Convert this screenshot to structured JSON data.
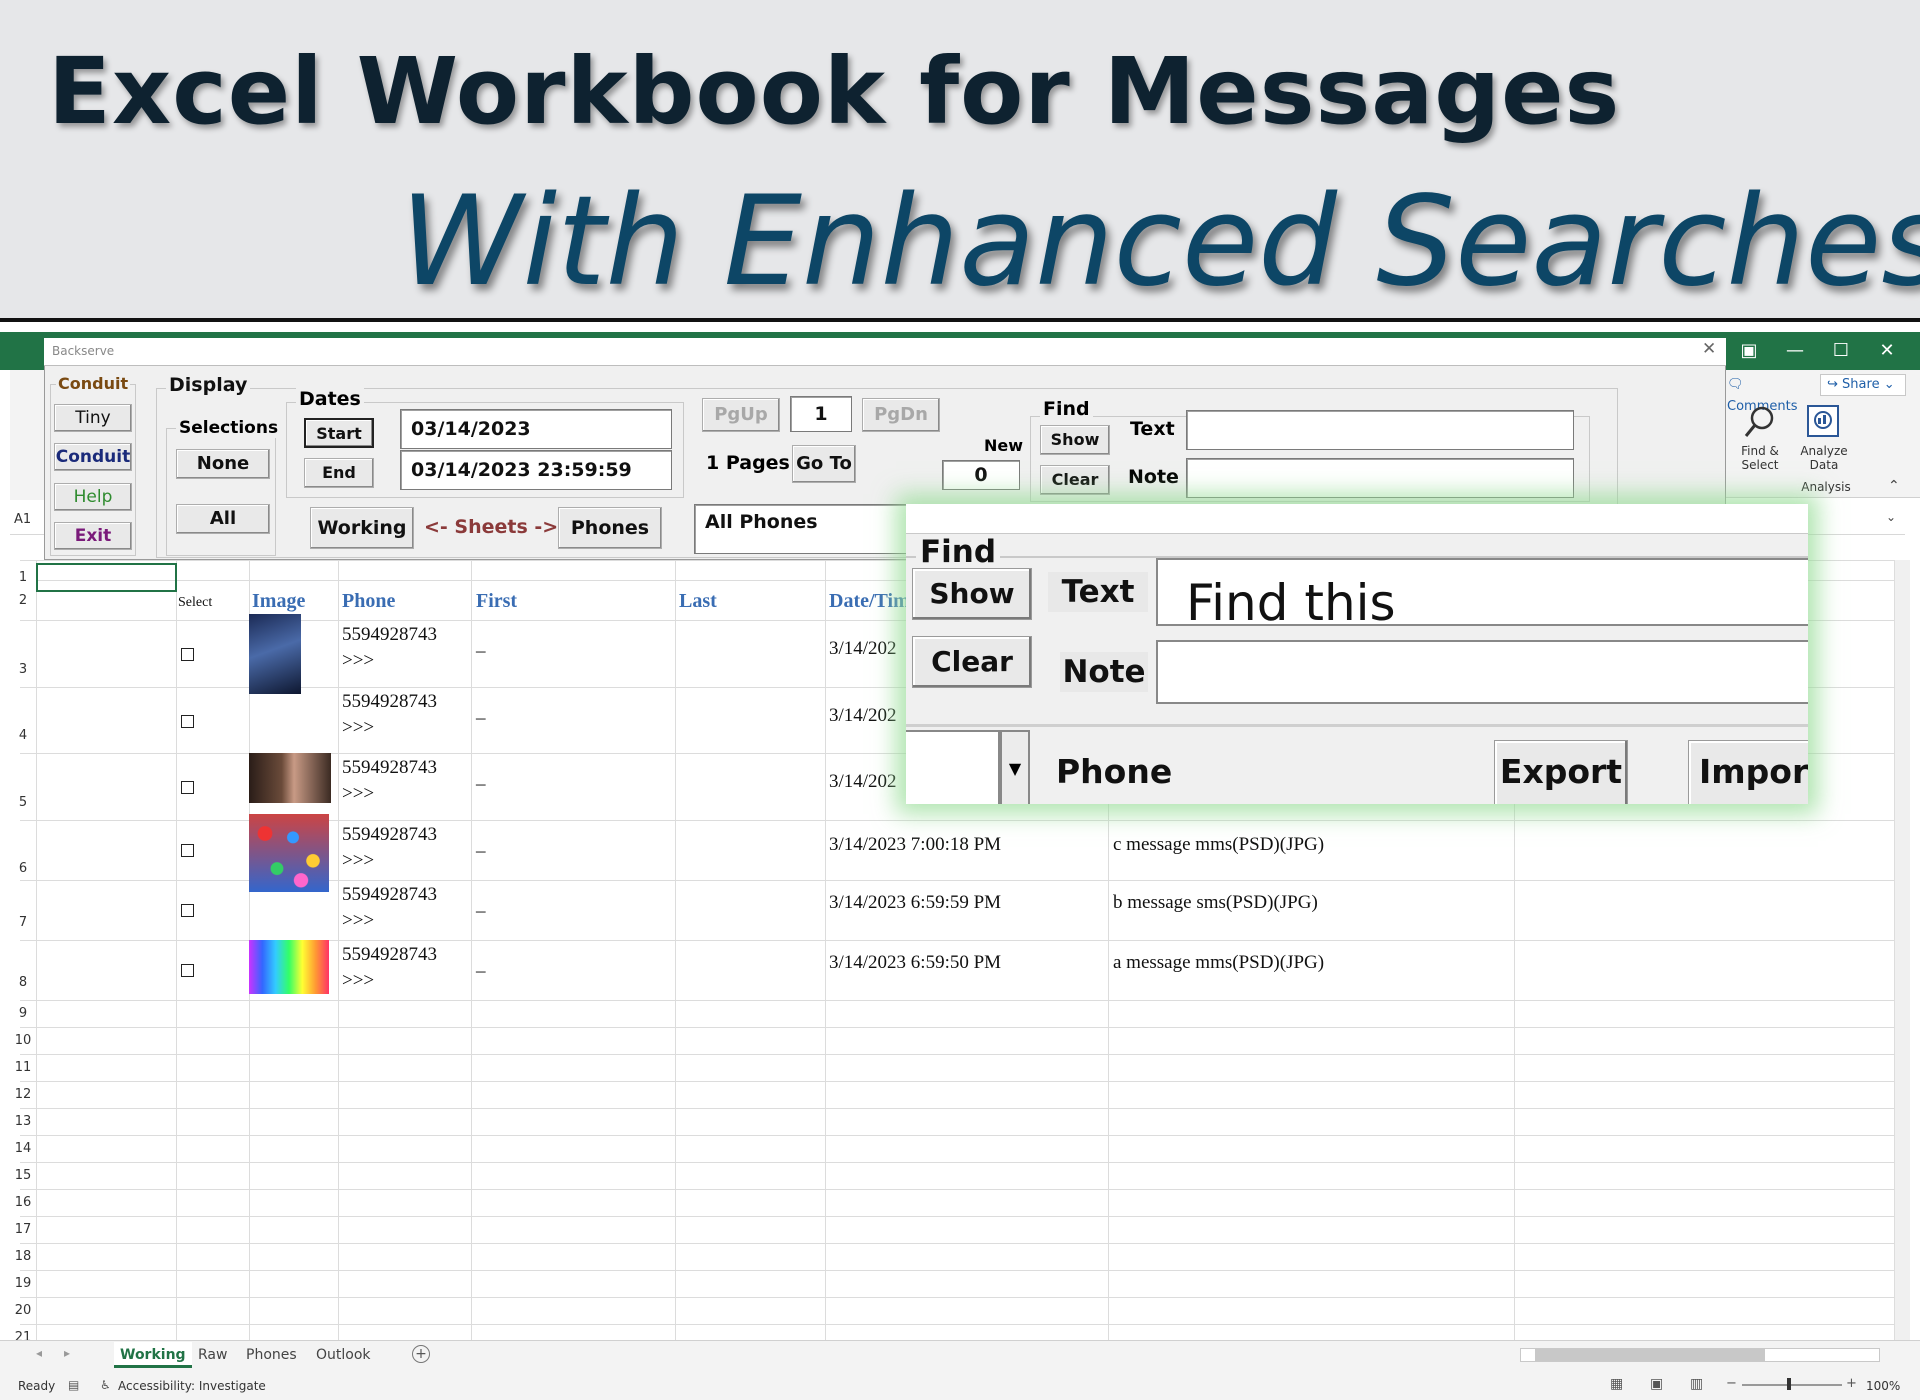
{
  "banner": {
    "title": "Excel Workbook for Messages",
    "subtitle": "With Enhanced Searches"
  },
  "excel": {
    "ribbon": {
      "comments": "Comments",
      "share": "Share",
      "find_select": "Find & Select",
      "analyze_data": "Analyze Data",
      "analysis_group": "Analysis"
    },
    "name_box": "A1",
    "columns": [
      "Select",
      "Image",
      "Phone",
      "First",
      "Last",
      "Date/Time"
    ],
    "row_numbers": [
      "1",
      "2",
      "3",
      "4",
      "5",
      "6",
      "7",
      "8",
      "9",
      "10",
      "11",
      "12",
      "13",
      "14",
      "15",
      "16",
      "17",
      "18",
      "19",
      "20",
      "21"
    ],
    "rows": [
      {
        "phone": "5594928743",
        "phone2": ">>>",
        "first": "_",
        "datetime": "3/14/202",
        "message": ""
      },
      {
        "phone": "5594928743",
        "phone2": ">>>",
        "first": "_",
        "datetime": "3/14/202",
        "message": ""
      },
      {
        "phone": "5594928743",
        "phone2": ">>>",
        "first": "_",
        "datetime": "3/14/202",
        "message": ""
      },
      {
        "phone": "5594928743",
        "phone2": ">>>",
        "first": "_",
        "datetime": "3/14/2023 7:00:18 PM",
        "message": "c message mms(PSD)(JPG)"
      },
      {
        "phone": "5594928743",
        "phone2": ">>>",
        "first": "_",
        "datetime": "3/14/2023 6:59:59 PM",
        "message": "b message sms(PSD)(JPG)"
      },
      {
        "phone": "5594928743",
        "phone2": ">>>",
        "first": "_",
        "datetime": "3/14/2023 6:59:50 PM",
        "message": "a message mms(PSD)(JPG)"
      }
    ],
    "sheet_tabs": [
      "Working",
      "Raw",
      "Phones",
      "Outlook"
    ],
    "active_tab": "Working",
    "status": {
      "ready": "Ready",
      "accessibility": "Accessibility: Investigate",
      "zoom": "100%"
    }
  },
  "form": {
    "window_title": "Backserve",
    "conduit_group": {
      "label": "Conduit",
      "tiny": "Tiny",
      "conduit": "Conduit",
      "help": "Help",
      "exit": "Exit"
    },
    "display_label": "Display",
    "selections": {
      "label": "Selections",
      "none": "None",
      "all": "All"
    },
    "dates": {
      "label": "Dates",
      "start": "Start",
      "end": "End",
      "start_value": "03/14/2023",
      "end_value": "03/14/2023 23:59:59"
    },
    "paging": {
      "pgup": "PgUp",
      "page": "1",
      "pgdn": "PgDn",
      "pages": "1 Pages",
      "goto": "Go To",
      "new_label": "New",
      "new_value": "0"
    },
    "sheets": {
      "working": "Working",
      "label": "<- Sheets ->",
      "phones": "Phones"
    },
    "phones_dropdown": "All Phones",
    "find": {
      "label": "Find",
      "show": "Show",
      "clear": "Clear",
      "text_label": "Text",
      "note_label": "Note",
      "text_value": "",
      "note_value": ""
    }
  },
  "zoom": {
    "find_label": "Find",
    "show": "Show",
    "clear": "Clear",
    "text_label": "Text",
    "text_value": "Find this",
    "note_label": "Note",
    "note_value": "",
    "phone": "Phone",
    "export": "Export",
    "import": "Import"
  },
  "colors": {
    "excel_green": "#217346",
    "header_blue": "#3a6db3",
    "conduit_brown": "#7a4a12",
    "conduit_navy": "#1a2a7a",
    "help_green": "#2e8b2e",
    "exit_purple": "#7a1a7a",
    "sheets_maroon": "#8b3a3a"
  }
}
